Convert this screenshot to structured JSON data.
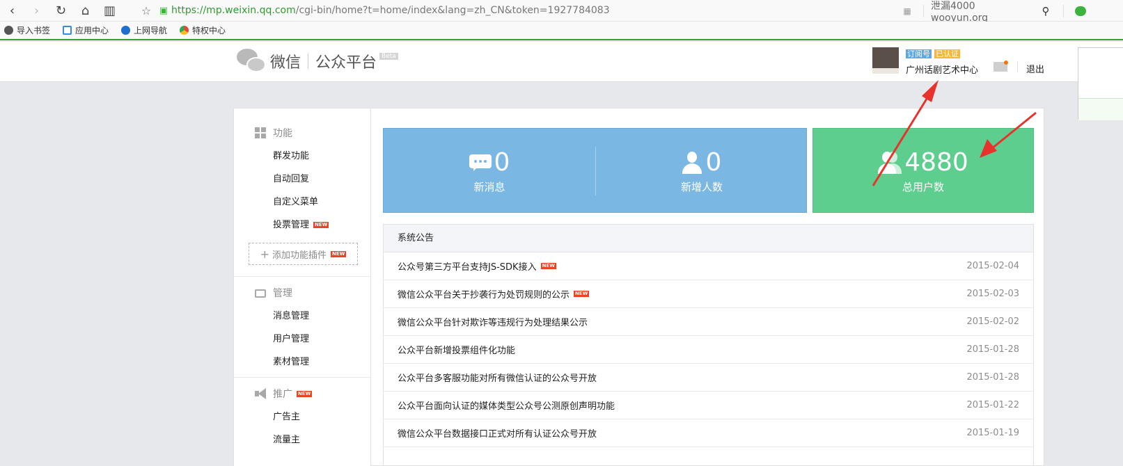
{
  "browser": {
    "url_host": "https://mp.weixin.qq.com",
    "url_rest": "/cgi-bin/home?t=home/index&lang=zh_CN&token=1927784083",
    "search_text": "泄漏4000 wooyun.org",
    "bookmarks": [
      {
        "label": "导入书签",
        "icon": "import-icon"
      },
      {
        "label": "应用中心",
        "icon": "bag-icon"
      },
      {
        "label": "上网导航",
        "icon": "ie-icon"
      },
      {
        "label": "特权中心",
        "icon": "chrome-icon"
      }
    ]
  },
  "header": {
    "logo_weixin": "微信",
    "logo_platform": "公众平台",
    "beta": "Beta",
    "tag_subscription": "订阅号",
    "tag_verified": "已认证",
    "account_name": "广州话剧艺术中心",
    "logout": "退出"
  },
  "sidebar": {
    "groups": [
      {
        "label": "功能",
        "icon": "grid-icon",
        "items": [
          "群发功能",
          "自动回复",
          "自定义菜单",
          "投票管理"
        ]
      },
      {
        "label": "管理",
        "icon": "inbox-icon",
        "items": [
          "消息管理",
          "用户管理",
          "素材管理"
        ]
      },
      {
        "label": "推广",
        "icon": "megaphone-icon",
        "items": [
          "广告主",
          "流量主"
        ]
      }
    ],
    "add_plugin": "添加功能插件",
    "new_badge": "NEW"
  },
  "stats": {
    "new_messages": {
      "value": "0",
      "label": "新消息"
    },
    "new_users": {
      "value": "0",
      "label": "新增人数"
    },
    "total_users": {
      "value": "4880",
      "label": "总用户数"
    }
  },
  "notice": {
    "title": "系统公告",
    "rows": [
      {
        "title": "公众号第三方平台支持JS-SDK接入",
        "date": "2015-02-04",
        "new": true
      },
      {
        "title": "微信公众平台关于抄袭行为处罚规则的公示",
        "date": "2015-02-03",
        "new": true
      },
      {
        "title": "微信公众平台针对欺诈等违规行为处理结果公示",
        "date": "2015-02-02",
        "new": false
      },
      {
        "title": "公众平台新增投票组件化功能",
        "date": "2015-01-28",
        "new": false
      },
      {
        "title": "公众平台多客服功能对所有微信认证的公众号开放",
        "date": "2015-01-28",
        "new": false
      },
      {
        "title": "公众平台面向认证的媒体类型公众号公测原创声明功能",
        "date": "2015-01-22",
        "new": false
      },
      {
        "title": "微信公众平台数据接口正式对所有认证公众号开放",
        "date": "2015-01-19",
        "new": false
      }
    ]
  },
  "colors": {
    "stat_blue": "#7bb7e3",
    "stat_green": "#5ece8f",
    "annotation_red": "#e8322c",
    "browser_accent": "#2ea534"
  }
}
